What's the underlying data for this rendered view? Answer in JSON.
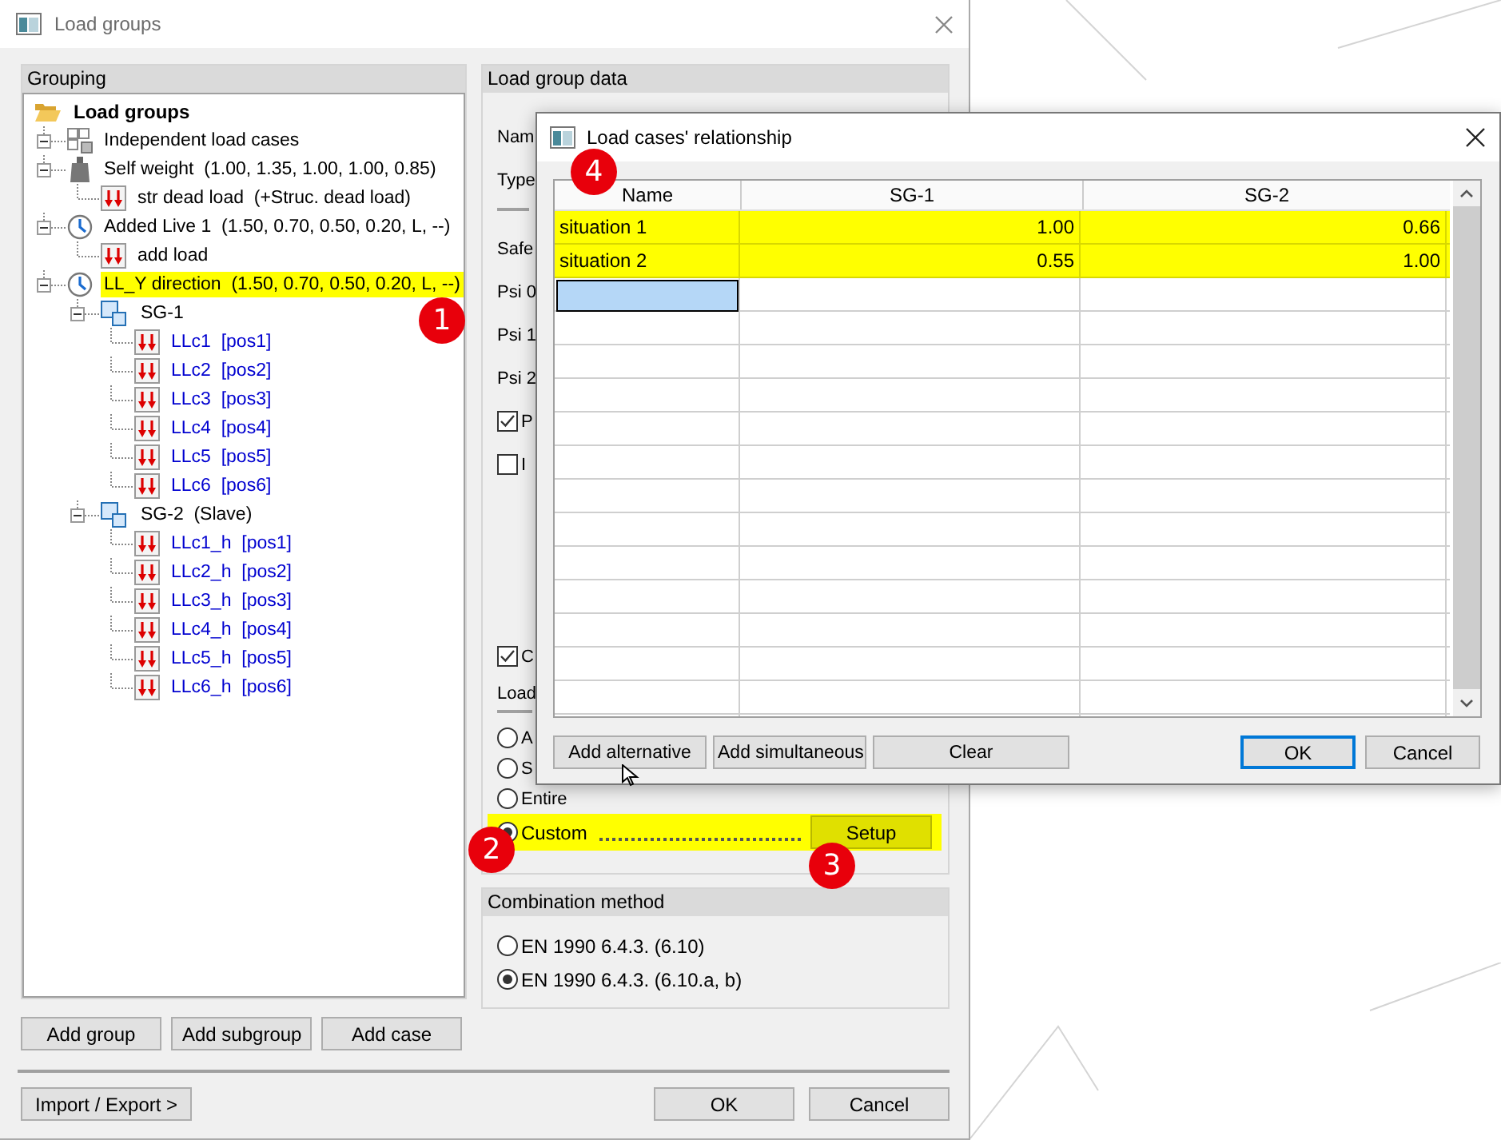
{
  "window": {
    "title": "Load groups"
  },
  "grouping": {
    "title": "Grouping",
    "tree": [
      {
        "label": "Load groups",
        "kind": "folder",
        "expanded": true,
        "children": [
          {
            "label": "Independent load cases",
            "kind": "independent",
            "expanded": true,
            "highlighted": false
          },
          {
            "label": "Self weight  (1.00, 1.35, 1.00, 1.00, 0.85)",
            "kind": "weight",
            "expanded": true,
            "highlighted": false,
            "children": [
              {
                "label": "str dead load  (+Struc. dead load)",
                "kind": "load",
                "highlighted": false
              }
            ]
          },
          {
            "label": "Added Live 1  (1.50, 0.70, 0.50, 0.20, L, --)",
            "kind": "clock",
            "expanded": true,
            "highlighted": false,
            "children": [
              {
                "label": "add load",
                "kind": "load",
                "highlighted": false
              }
            ]
          },
          {
            "label": "LL_Y direction  (1.50, 0.70, 0.50, 0.20, L, --)",
            "kind": "clock",
            "expanded": true,
            "highlighted": true,
            "children": [
              {
                "label": "SG-1",
                "kind": "subgroup",
                "expanded": true,
                "highlighted": false,
                "children": [
                  {
                    "label": "LLc1  [pos1]",
                    "kind": "case",
                    "highlighted": false
                  },
                  {
                    "label": "LLc2  [pos2]",
                    "kind": "case",
                    "highlighted": false
                  },
                  {
                    "label": "LLc3  [pos3]",
                    "kind": "case",
                    "highlighted": false
                  },
                  {
                    "label": "LLc4  [pos4]",
                    "kind": "case",
                    "highlighted": false
                  },
                  {
                    "label": "LLc5  [pos5]",
                    "kind": "case",
                    "highlighted": false
                  },
                  {
                    "label": "LLc6  [pos6]",
                    "kind": "case",
                    "highlighted": false
                  }
                ]
              },
              {
                "label": "SG-2  (Slave)",
                "kind": "subgroup",
                "expanded": true,
                "highlighted": false,
                "children": [
                  {
                    "label": "LLc1_h  [pos1]",
                    "kind": "case",
                    "highlighted": false
                  },
                  {
                    "label": "LLc2_h  [pos2]",
                    "kind": "case",
                    "highlighted": false
                  },
                  {
                    "label": "LLc3_h  [pos3]",
                    "kind": "case",
                    "highlighted": false
                  },
                  {
                    "label": "LLc4_h  [pos4]",
                    "kind": "case",
                    "highlighted": false
                  },
                  {
                    "label": "LLc5_h  [pos5]",
                    "kind": "case",
                    "highlighted": false
                  },
                  {
                    "label": "LLc6_h  [pos6]",
                    "kind": "case",
                    "highlighted": false
                  }
                ]
              }
            ]
          }
        ]
      }
    ],
    "buttons": [
      "Add group",
      "Add subgroup",
      "Add case"
    ]
  },
  "load_group_data": {
    "title": "Load group data",
    "upper_items": [
      {
        "kind": "label",
        "text": "Nam"
      },
      {
        "kind": "label",
        "text": "Type"
      },
      {
        "kind": "rule"
      },
      {
        "kind": "label",
        "text": "Safe"
      },
      {
        "kind": "label",
        "text": "Psi 0"
      },
      {
        "kind": "label",
        "text": "Psi 1"
      },
      {
        "kind": "label",
        "text": "Psi 2"
      },
      {
        "kind": "checkbox",
        "text": "P",
        "checked": true
      },
      {
        "kind": "checkbox",
        "text": "I",
        "checked": false
      }
    ],
    "lower_items": [
      {
        "kind": "checkbox",
        "text": "C",
        "checked": true
      },
      {
        "kind": "heading",
        "text": "Load"
      },
      {
        "kind": "radio",
        "text": "A",
        "selected": false
      },
      {
        "kind": "radio",
        "text": "S",
        "selected": false
      },
      {
        "kind": "radio",
        "text": "Entire",
        "selected": false
      },
      {
        "kind": "radio",
        "text": "Custom",
        "selected": true,
        "highlighted": true,
        "button": "Setup"
      }
    ]
  },
  "combination_method": {
    "title": "Combination method",
    "options": [
      {
        "label": "EN 1990 6.4.3. (6.10)",
        "selected": false
      },
      {
        "label": "EN 1990 6.4.3. (6.10.a, b)",
        "selected": true
      }
    ]
  },
  "footer": {
    "import_export": "Import / Export >",
    "buttons": [
      "OK",
      "Cancel"
    ]
  },
  "dialog": {
    "title": "Load cases' relationship",
    "grid": {
      "columns": [
        "Name",
        "SG-1",
        "SG-2"
      ],
      "rows": [
        {
          "cells": [
            "situation 1",
            "1.00",
            "0.66"
          ],
          "highlighted": true
        },
        {
          "cells": [
            "situation 2",
            "0.55",
            "1.00"
          ],
          "highlighted": true
        }
      ],
      "new_row": {
        "selected": true
      }
    },
    "left_buttons": [
      "Add alternative",
      "Add simultaneous",
      "Clear"
    ],
    "right_buttons": [
      {
        "label": "OK",
        "default": true
      },
      {
        "label": "Cancel",
        "default": false
      }
    ]
  },
  "annotations": [
    {
      "number": "1"
    },
    {
      "number": "2"
    },
    {
      "number": "3"
    },
    {
      "number": "4"
    }
  ]
}
